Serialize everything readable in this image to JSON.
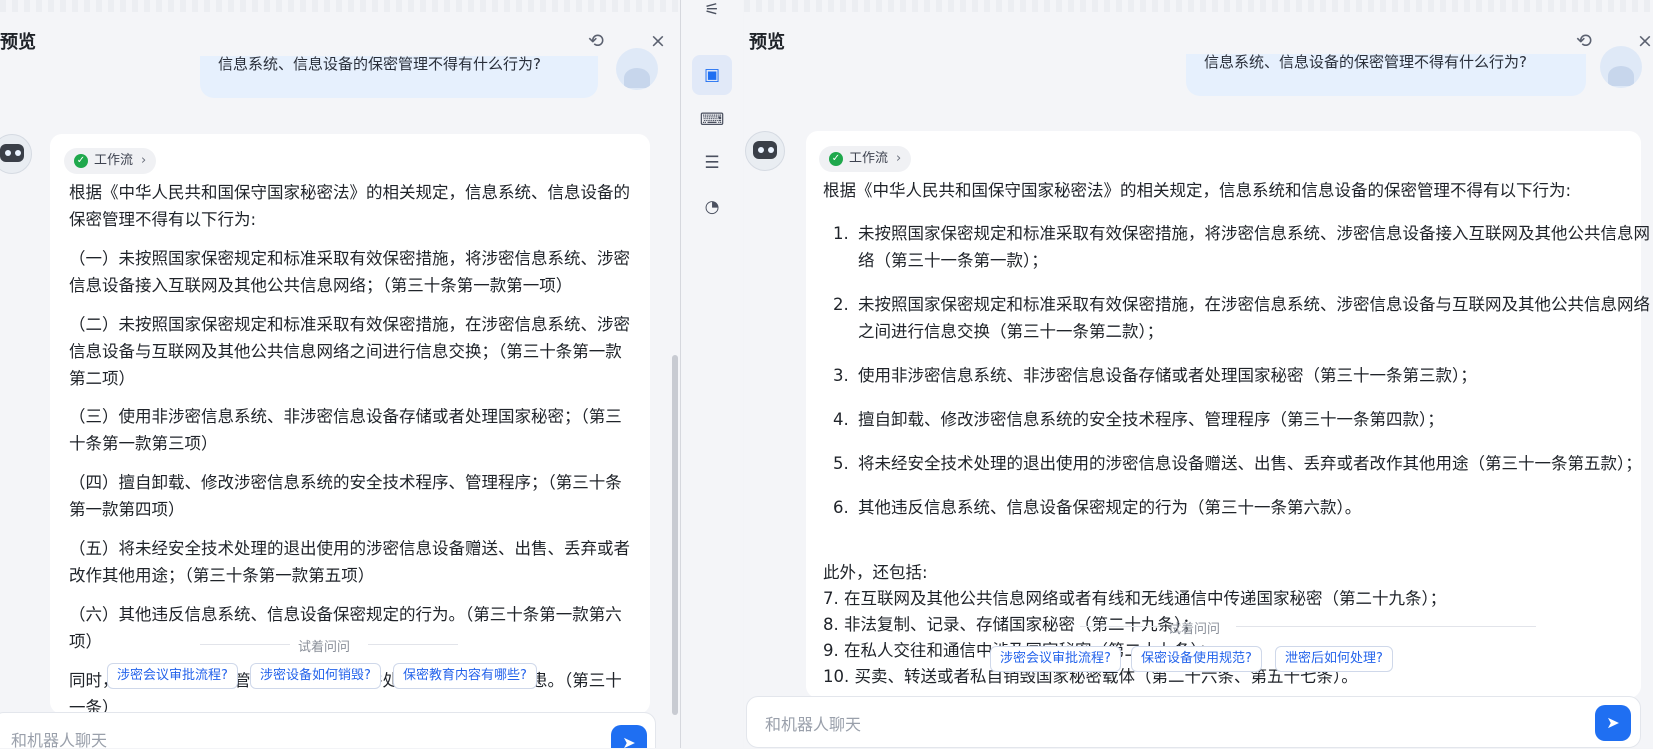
{
  "left": {
    "title": "预览",
    "user_question": "信息系统、信息设备的保密管理不得有什么行为?",
    "workflow_label": "工作流",
    "answer_paragraphs": [
      "根据《中华人民共和国保守国家秘密法》的相关规定，信息系统、信息设备的保密管理不得有以下行为:",
      "（一）未按照国家保密规定和标准采取有效保密措施，将涉密信息系统、涉密信息设备接入互联网及其他公共信息网络；（第三十条第一款第一项）",
      "（二）未按照国家保密规定和标准采取有效保密措施，在涉密信息系统、涉密信息设备与互联网及其他公共信息网络之间进行信息交换；（第三十条第一款第二项）",
      "（三）使用非涉密信息系统、非涉密信息设备存储或者处理国家秘密；（第三十条第一款第三项）",
      "（四）擅自卸载、修改涉密信息系统的安全技术程序、管理程序；（第三十条第一款第四项）",
      "（五）将未经安全技术处理的退出使用的涉密信息设备赠送、出售、丢弃或者改作其他用途；（第三十条第一款第五项）",
      "（六）其他违反信息系统、信息设备保密规定的行为。（第三十条第一款第六项）",
      "同时，…建设保密自监管设施，及时发现并处置安全保密风险隐患。（第三十一条）"
    ],
    "try_label": "试着问问",
    "suggestions": [
      "涉密会议审批流程?",
      "涉密设备如何销毁?",
      "保密教育内容有哪些?"
    ],
    "input_placeholder": "和机器人聊天"
  },
  "toolbar": {
    "items": [
      "settings-sliders-icon",
      "preview-window-icon",
      "terminal-icon",
      "document-list-icon",
      "gauge-icon"
    ]
  },
  "right": {
    "title": "预览",
    "user_question": "信息系统、信息设备的保密管理不得有什么行为?",
    "workflow_label": "工作流",
    "intro": "根据《中华人民共和国保守国家秘密法》的相关规定，信息系统和信息设备的保密管理不得有以下行为:",
    "items": [
      "未按照国家保密规定和标准采取有效保密措施，将涉密信息系统、涉密信息设备接入互联网及其他公共信息网络（第三十一条第一款）；",
      "未按照国家保密规定和标准采取有效保密措施，在涉密信息系统、涉密信息设备与互联网及其他公共信息网络之间进行信息交换（第三十一条第二款）；",
      "使用非涉密信息系统、非涉密信息设备存储或者处理国家秘密（第三十一条第三款）；",
      "擅自卸载、修改涉密信息系统的安全技术程序、管理程序（第三十一条第四款）；",
      "将未经安全技术处理的退出使用的涉密信息设备赠送、出售、丢弃或者改作其他用途（第三十一条第五款）；",
      "其他违反信息系统、信息设备保密规定的行为（第三十一条第六款）。"
    ],
    "also_label": "此外，还包括:",
    "extra": [
      "7. 在互联网及其他公共信息网络或者有线和无线通信中传递国家秘密（第二十九条）；",
      "8. 非法复制、记录、存储国家秘密（第二十九条）；",
      "9. 在私人交往和通信中涉及国家秘密（第二十九条）；",
      "10. 买卖、转送或者私自销毁国家秘密载体（第二十六条、第五十七条）。"
    ],
    "try_label": "试着问问",
    "suggestions": [
      "涉密会议审批流程?",
      "保密设备使用规范?",
      "泄密后如何处理?"
    ],
    "input_placeholder": "和机器人聊天"
  },
  "colors": {
    "accent": "#1f6ff2",
    "user_bubble": "#e6f0fd",
    "chip_text": "#2463eb",
    "success": "#1fa84c"
  }
}
